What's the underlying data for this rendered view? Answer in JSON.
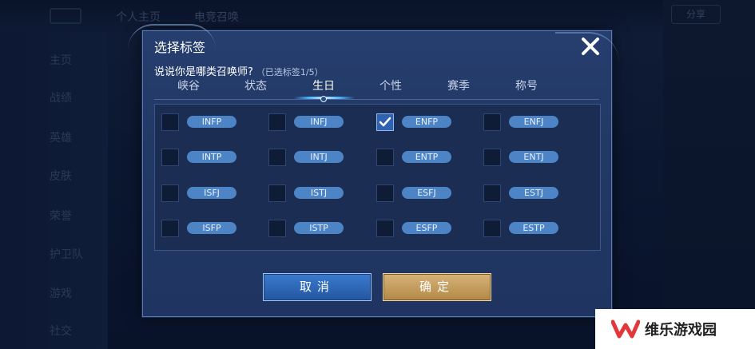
{
  "background": {
    "tabs": [
      "个人主页",
      "电竞召唤"
    ],
    "sidebar": [
      "主页",
      "战绩",
      "英雄",
      "皮肤",
      "荣誉",
      "护卫队",
      "游戏",
      "社交"
    ],
    "right_pill": "分享"
  },
  "dialog": {
    "title": "选择标签",
    "prompt": "说说你是哪类召唤师?",
    "selected_count": "（已选标签1/5）",
    "tabs": [
      {
        "label": "峡谷"
      },
      {
        "label": "状态"
      },
      {
        "label": "生日"
      },
      {
        "label": "个性"
      },
      {
        "label": "赛季"
      },
      {
        "label": "称号"
      }
    ],
    "active_tab": "生日",
    "tags": [
      {
        "label": "INFP",
        "checked": false
      },
      {
        "label": "INFJ",
        "checked": false
      },
      {
        "label": "ENFP",
        "checked": true
      },
      {
        "label": "ENFJ",
        "checked": false
      },
      {
        "label": "INTP",
        "checked": false
      },
      {
        "label": "INTJ",
        "checked": false
      },
      {
        "label": "ENTP",
        "checked": false
      },
      {
        "label": "ENTJ",
        "checked": false
      },
      {
        "label": "ISFJ",
        "checked": false
      },
      {
        "label": "ISTJ",
        "checked": false
      },
      {
        "label": "ESFJ",
        "checked": false
      },
      {
        "label": "ESTJ",
        "checked": false
      },
      {
        "label": "ISFP",
        "checked": false
      },
      {
        "label": "ISTP",
        "checked": false
      },
      {
        "label": "ESFP",
        "checked": false
      },
      {
        "label": "ESTP",
        "checked": false
      }
    ],
    "cancel_label": "取消",
    "confirm_label": "确定",
    "close_icon": "close-icon"
  },
  "watermark": {
    "text": "维乐游戏园",
    "logo_icon": "w-logo-icon"
  },
  "colors": {
    "dialog_bg": "#223865",
    "tag_bg": "#4d84c5",
    "checkbox_checked": "#2f62b0",
    "cancel_button": "#2f67b8",
    "confirm_button": "#c49e5d",
    "watermark_logo_red": "#e2383a"
  }
}
